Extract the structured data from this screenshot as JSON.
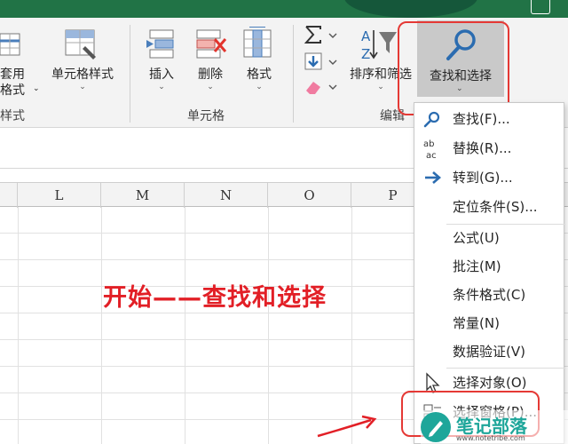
{
  "ribbon": {
    "styles_group": {
      "table_format_label_partial": "套用",
      "table_format_label_line2": "格式",
      "cell_styles_label": "单元格样式",
      "group_label_partial": "样式"
    },
    "cells_group": {
      "insert_label": "插入",
      "delete_label": "删除",
      "format_label": "格式",
      "group_label": "单元格"
    },
    "editing_group": {
      "sort_filter_label": "排序和筛选",
      "find_select_label": "查找和选择",
      "group_label_partial": "编辑"
    }
  },
  "columns": [
    "L",
    "M",
    "N",
    "O",
    "P"
  ],
  "annotation": "开始——查找和选择",
  "menu": {
    "items": [
      {
        "label": "查找(F)...",
        "icon": "search-icon"
      },
      {
        "label": "替换(R)...",
        "icon": "replace-abc-icon"
      },
      {
        "label": "转到(G)...",
        "icon": "arrow-right-icon"
      },
      {
        "label": "定位条件(S)...",
        "icon": ""
      },
      {
        "label": "公式(U)",
        "icon": ""
      },
      {
        "label": "批注(M)",
        "icon": ""
      },
      {
        "label": "条件格式(C)",
        "icon": ""
      },
      {
        "label": "常量(N)",
        "icon": ""
      },
      {
        "label": "数据验证(V)",
        "icon": ""
      },
      {
        "label": "选择对象(O)",
        "icon": "cursor-icon"
      },
      {
        "label": "选择窗格(P)...",
        "icon": "selection-pane-icon"
      }
    ]
  },
  "watermark": {
    "name": "笔记部落",
    "url": "www.notetribe.com"
  },
  "colors": {
    "excel_green": "#217346",
    "highlight_red": "#e53935",
    "watermark_teal": "#1ea69a"
  }
}
